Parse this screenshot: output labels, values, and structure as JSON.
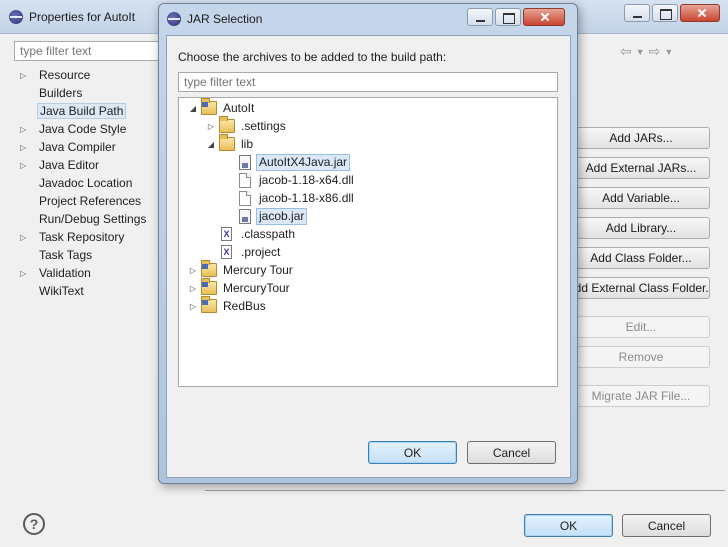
{
  "properties_window": {
    "title": "Properties for AutoIt",
    "filter_placeholder": "type filter text",
    "tree": [
      {
        "label": "Resource",
        "expandable": true
      },
      {
        "label": "Builders",
        "expandable": false
      },
      {
        "label": "Java Build Path",
        "expandable": false,
        "selected": true
      },
      {
        "label": "Java Code Style",
        "expandable": true
      },
      {
        "label": "Java Compiler",
        "expandable": true
      },
      {
        "label": "Java Editor",
        "expandable": true
      },
      {
        "label": "Javadoc Location",
        "expandable": false
      },
      {
        "label": "Project References",
        "expandable": false
      },
      {
        "label": "Run/Debug Settings",
        "expandable": false
      },
      {
        "label": "Task Repository",
        "expandable": true
      },
      {
        "label": "Task Tags",
        "expandable": false
      },
      {
        "label": "Validation",
        "expandable": true
      },
      {
        "label": "WikiText",
        "expandable": false
      }
    ],
    "side_buttons": {
      "add_jars": "Add JARs...",
      "add_external_jars": "Add External JARs...",
      "add_variable": "Add Variable...",
      "add_library": "Add Library...",
      "add_class_folder": "Add Class Folder...",
      "add_external_class_folder": "Add External Class Folder...",
      "edit": "Edit...",
      "remove": "Remove",
      "migrate_jar_file": "Migrate JAR File..."
    },
    "help_glyph": "?",
    "ok_label": "OK",
    "cancel_label": "Cancel"
  },
  "jar_dialog": {
    "title": "JAR Selection",
    "message": "Choose the archives to be added to the build path:",
    "filter_placeholder": "type filter text",
    "tree": [
      {
        "label": "AutoIt",
        "icon": "project",
        "arrow": "expanded",
        "depth": 0
      },
      {
        "label": ".settings",
        "icon": "folder",
        "arrow": "collapsed",
        "depth": 1
      },
      {
        "label": "lib",
        "icon": "folder",
        "arrow": "expanded",
        "depth": 1
      },
      {
        "label": "AutoItX4Java.jar",
        "icon": "jar",
        "arrow": "none",
        "depth": 2,
        "selected": true
      },
      {
        "label": "jacob-1.18-x64.dll",
        "icon": "file",
        "arrow": "none",
        "depth": 2
      },
      {
        "label": "jacob-1.18-x86.dll",
        "icon": "file",
        "arrow": "none",
        "depth": 2
      },
      {
        "label": "jacob.jar",
        "icon": "jar",
        "arrow": "none",
        "depth": 2,
        "selected": true
      },
      {
        "label": ".classpath",
        "icon": "x",
        "arrow": "none",
        "depth": 1
      },
      {
        "label": ".project",
        "icon": "x",
        "arrow": "none",
        "depth": 1
      },
      {
        "label": "Mercury Tour",
        "icon": "project",
        "arrow": "collapsed",
        "depth": 0
      },
      {
        "label": "MercuryTour",
        "icon": "project",
        "arrow": "collapsed",
        "depth": 0
      },
      {
        "label": "RedBus",
        "icon": "project",
        "arrow": "collapsed",
        "depth": 0
      }
    ],
    "ok_label": "OK",
    "cancel_label": "Cancel"
  },
  "icon_names": {
    "window": "eclipse-icon",
    "project": "java-project-icon",
    "folder": "folder-icon",
    "jar": "jar-file-icon",
    "file": "file-icon",
    "x": "xml-file-icon"
  },
  "colors": {
    "selection_bg": "#dbe8f8",
    "selection_border": "#99bde5",
    "default_button": "#c4e0f7",
    "title_bar": "#c6d6ea"
  }
}
